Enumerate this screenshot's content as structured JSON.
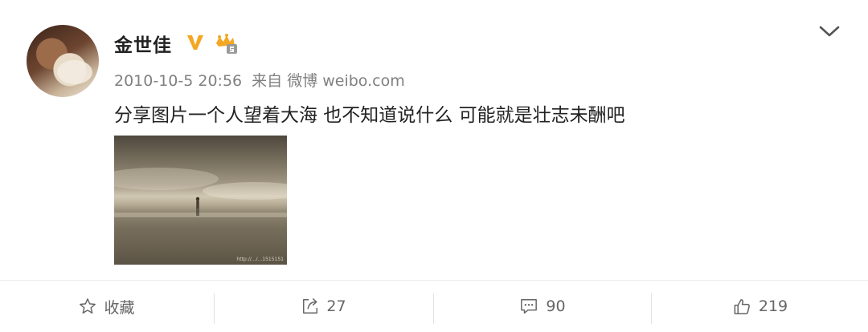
{
  "post": {
    "username": "金世佳",
    "meta": {
      "datetime": "2010-10-5 20:56",
      "source_prefix": "来自",
      "source": "微博 weibo.com"
    },
    "text": "分享图片一个人望着大海 也不知道说什么 可能就是壮志未酬吧",
    "image": {
      "watermark": "http://.../...1515151"
    }
  },
  "icons": {
    "verified": "verified-v-icon",
    "vip": "vip-crown-badge-icon",
    "menu": "chevron-down-icon",
    "favorite": "star-icon",
    "repost": "share-arrow-icon",
    "comment": "comment-bubble-icon",
    "like": "thumbs-up-icon"
  },
  "colors": {
    "verified": "#f5a623",
    "text": "#222222",
    "meta": "#808080",
    "action": "#666666"
  },
  "actions": {
    "favorite_label": "收藏",
    "repost_count": "27",
    "comment_count": "90",
    "like_count": "219"
  }
}
